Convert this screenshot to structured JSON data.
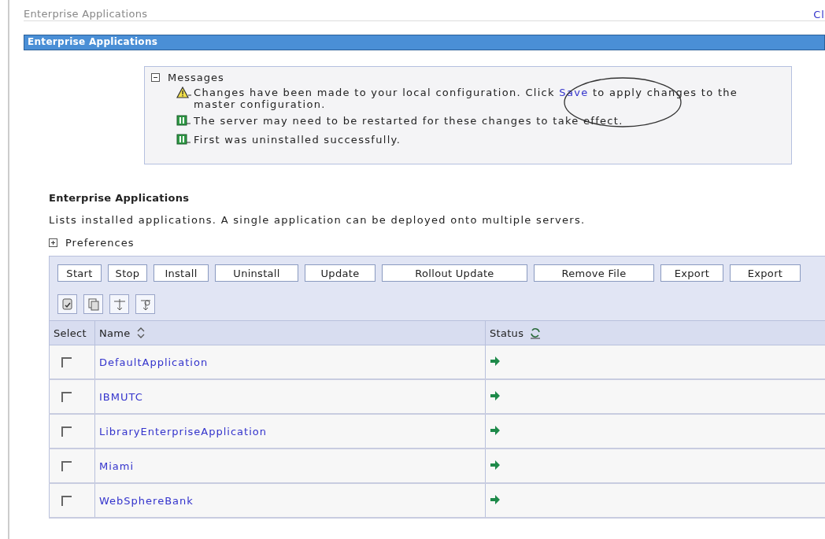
{
  "breadcrumb": "Enterprise Applications",
  "close_link": "Cl",
  "panel_title": "Enterprise Applications",
  "messages": {
    "title": "Messages",
    "expanded": true,
    "annotation_circle": true,
    "items": [
      {
        "kind": "warning",
        "before": "Changes have been made to your local configuration. Click ",
        "link": "Save",
        "after": " to apply changes to the master configuration."
      },
      {
        "kind": "info",
        "before": "The server may need to be restarted for these changes to take effect."
      },
      {
        "kind": "info",
        "before": "First was uninstalled successfully."
      }
    ]
  },
  "section_title": "Enterprise Applications",
  "description": "Lists installed applications. A single application can be deployed onto multiple servers.",
  "preferences": {
    "label": "Preferences",
    "expanded": false
  },
  "buttons": [
    "Start",
    "Stop",
    "Install",
    "Uninstall",
    "Update",
    "Rollout Update",
    "Remove File",
    "Export",
    "Export"
  ],
  "table": {
    "columns": [
      "Select",
      "Name",
      "Status"
    ],
    "rows": [
      {
        "checked": false,
        "name": "DefaultApplication",
        "running": true
      },
      {
        "checked": false,
        "name": "IBMUTC",
        "running": true
      },
      {
        "checked": false,
        "name": "LibraryEnterpriseApplication",
        "running": true
      },
      {
        "checked": false,
        "name": "Miami",
        "running": true
      },
      {
        "checked": false,
        "name": "WebSphereBank",
        "running": true
      }
    ]
  }
}
